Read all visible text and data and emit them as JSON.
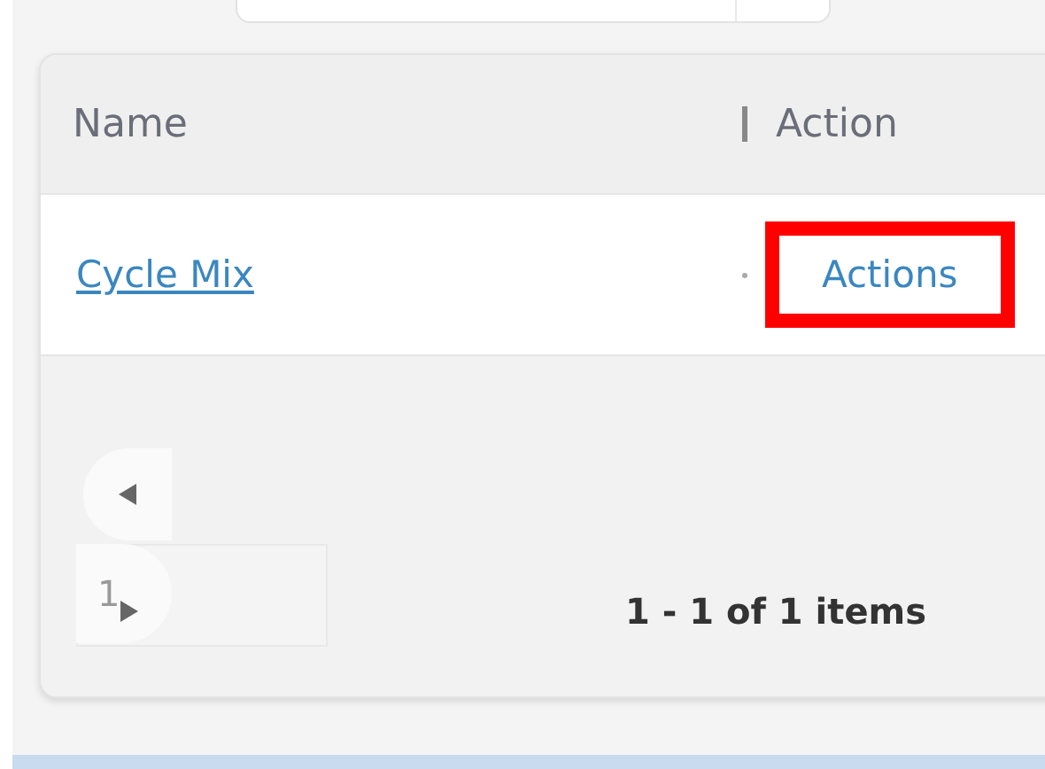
{
  "table": {
    "columns": [
      {
        "label": "Name"
      },
      {
        "label": "Action"
      }
    ],
    "rows": [
      {
        "name": "Cycle Mix",
        "action": "Actions",
        "highlighted": true
      }
    ]
  },
  "pager": {
    "page": "1",
    "summary": "1 - 1 of 1 items"
  }
}
